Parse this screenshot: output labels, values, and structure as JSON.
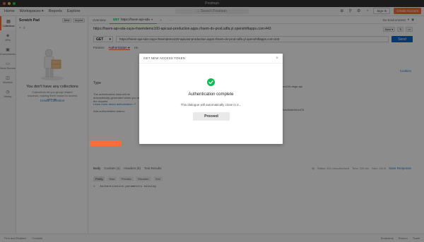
{
  "window": {
    "title": "Postman"
  },
  "header": {
    "nav": [
      "Home",
      "Workspaces",
      "Reports",
      "Explore"
    ],
    "search_placeholder": "Search Postman",
    "sign_in": "Sign In",
    "create_account": "Create Account"
  },
  "sidebar": {
    "workspace": "Scratch Pad",
    "new_label": "New",
    "import_label": "Import",
    "rail": [
      {
        "label": "Collections",
        "icon": "collections-icon"
      },
      {
        "label": "APIs",
        "icon": "api-icon"
      },
      {
        "label": "Environments",
        "icon": "environments-icon"
      },
      {
        "label": "Mock Servers",
        "icon": "mock-servers-icon"
      },
      {
        "label": "Monitors",
        "icon": "monitors-icon"
      },
      {
        "label": "History",
        "icon": "history-icon"
      }
    ],
    "empty_title": "You don't have any collections",
    "empty_text": "Collections let you group related requests, making them easier to access and run.",
    "empty_link": "Create Collection"
  },
  "tabs": {
    "overview": "Overview",
    "active_tab": "https://hsem-api-sda",
    "env": "No Environment"
  },
  "request": {
    "url_title": "https://hsem-api-sda-zaya-rhsemdemo100-apicast-production.apps.rhsem-dv-prod.sdfa.yl.openshiftapps.com:443",
    "method": "GET",
    "url": "https://hsem-api-sda-zaya-rhsemdemo100-apicast-production.apps.rhsem-dv-prod.sdfa.yl.openshiftapps.com:443",
    "send": "Send",
    "subtabs": [
      "Params",
      "Authorization ●",
      "He"
    ],
    "cookies": "Cookies",
    "type_label": "Type",
    "desc": "The authorization data will be automatically generated when you send the request.",
    "help_link": "Learn more about authorization ↗",
    "add_to_label": "Add authorization data to",
    "right_values": [
      "dev100-rtsgn-api",
      "t2cfc5d4e9hr1d75"
    ]
  },
  "response": {
    "tabs": [
      "Body",
      "Cookies (1)",
      "Headers (5)",
      "Test Results"
    ],
    "meta": [
      "Status: 401 Unauthorized",
      "Time: 325 ms",
      "Size: 110 B"
    ],
    "save": "Save Response",
    "formats": [
      "Pretty",
      "Raw",
      "Preview",
      "Visualize",
      "Text"
    ],
    "line_no": "1",
    "line_text": "Authentication parameters missing"
  },
  "statusbar": {
    "left": [
      "Find and Replace",
      "Console"
    ],
    "right": [
      "Bootcamp",
      "Runner",
      "Trash"
    ]
  },
  "modal": {
    "header": "GET NEW ACCESS TOKEN",
    "title": "Authentication complete",
    "subtitle": "This dialogue will automatically close in 2...",
    "proceed": "Proceed"
  },
  "colors": {
    "accent": "#ff6c37",
    "primary": "#0265d2",
    "success": "#0cbb52"
  }
}
